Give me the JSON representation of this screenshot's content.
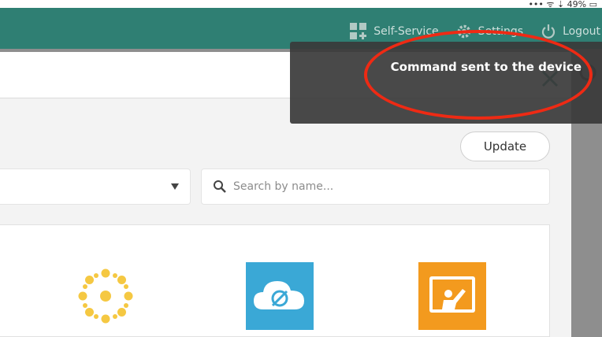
{
  "status_bar": {
    "text": "••• ᯤ  ⇣ 49% ▭"
  },
  "nav": {
    "self_service": "Self-Service",
    "settings": "Settings",
    "logout": "Logout"
  },
  "toolbar": {
    "update_label": "Update"
  },
  "search": {
    "placeholder": "Search by name..."
  },
  "toast": {
    "message": "Command sent to the device"
  },
  "apps": [
    {
      "icon": "canvas-sun-icon"
    },
    {
      "icon": "cloud-app-icon"
    },
    {
      "icon": "teacher-board-icon"
    }
  ],
  "colors": {
    "header": "#2f7f73",
    "toast": "#3a3a3a",
    "annotation": "#ee2a14",
    "sun": "#f5c842",
    "cloud_tile": "#3aa8d6",
    "teacher_tile": "#f39a1e"
  }
}
